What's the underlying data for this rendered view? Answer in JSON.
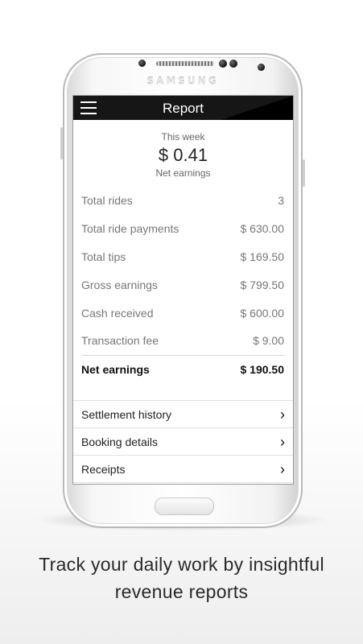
{
  "device": {
    "brand": "SAMSUNG"
  },
  "app_bar": {
    "title": "Report",
    "menu_icon": "hamburger-menu-icon"
  },
  "summary": {
    "period": "This week",
    "amount": "$ 0.41",
    "label": "Net earnings"
  },
  "rows": [
    {
      "label": "Total rides",
      "value": "3"
    },
    {
      "label": "Total ride payments",
      "value": "$ 630.00"
    },
    {
      "label": "Total tips",
      "value": "$ 169.50"
    },
    {
      "label": "Gross earnings",
      "value": "$ 799.50"
    },
    {
      "label": "Cash received",
      "value": "$ 600.00"
    },
    {
      "label": "Transaction fee",
      "value": "$ 9.00"
    }
  ],
  "total": {
    "label": "Net earnings",
    "value": "$ 190.50"
  },
  "links": [
    {
      "label": "Settlement history",
      "icon": "chevron-right-icon"
    },
    {
      "label": "Booking details",
      "icon": "chevron-right-icon"
    },
    {
      "label": "Receipts",
      "icon": "chevron-right-icon"
    }
  ],
  "caption": {
    "line1": "Track your daily work by insightful",
    "line2": "revenue reports"
  },
  "colors": {
    "app_bar": "#161616",
    "background": "#ffffff"
  }
}
